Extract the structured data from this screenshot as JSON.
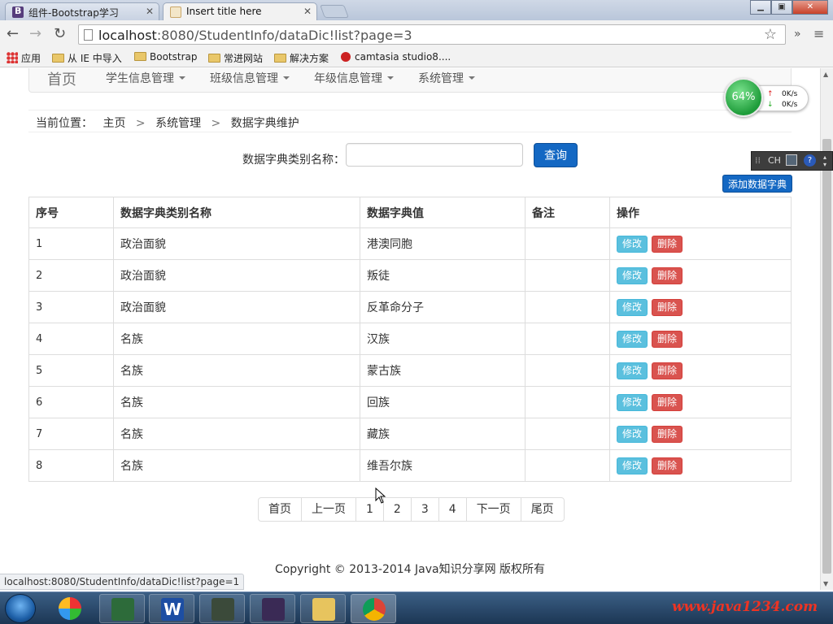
{
  "browser": {
    "tabs": [
      {
        "title": "组件-Bootstrap学习",
        "active": false,
        "favicon_color": "#563d7c"
      },
      {
        "title": "Insert title here",
        "active": true,
        "favicon_color": "#caa76a"
      }
    ],
    "url_host": "localhost",
    "url_rest": ":8080/StudentInfo/dataDic!list?page=3",
    "bookmarks": [
      {
        "label": "应用",
        "icon": "apps-icon"
      },
      {
        "label": "从 IE 中导入",
        "icon": "folder-icon"
      },
      {
        "label": "Bootstrap",
        "icon": "folder-icon"
      },
      {
        "label": "常进网站",
        "icon": "folder-icon"
      },
      {
        "label": "解决方案",
        "icon": "folder-icon"
      },
      {
        "label": "camtasia studio8....",
        "icon": "camtasia-icon"
      }
    ],
    "more_label": "»",
    "status_url": "localhost:8080/StudentInfo/dataDic!list?page=1"
  },
  "nav": {
    "brand": "首页",
    "menus": [
      "学生信息管理",
      "班级信息管理",
      "年级信息管理",
      "系统管理"
    ]
  },
  "breadcrumb": {
    "prefix": "当前位置：",
    "items": [
      "主页",
      "系统管理",
      "数据字典维护"
    ],
    "separator": ">"
  },
  "search": {
    "label": "数据字典类别名称：",
    "value": "",
    "button": "查询"
  },
  "add_button": "添加数据字典",
  "table": {
    "headers": [
      "序号",
      "数据字典类别名称",
      "数据字典值",
      "备注",
      "操作"
    ],
    "edit_label": "修改",
    "delete_label": "删除",
    "rows": [
      {
        "no": "1",
        "type": "政治面貌",
        "value": "港澳同胞",
        "remark": ""
      },
      {
        "no": "2",
        "type": "政治面貌",
        "value": "叛徒",
        "remark": ""
      },
      {
        "no": "3",
        "type": "政治面貌",
        "value": "反革命分子",
        "remark": ""
      },
      {
        "no": "4",
        "type": "名族",
        "value": "汉族",
        "remark": ""
      },
      {
        "no": "5",
        "type": "名族",
        "value": "蒙古族",
        "remark": ""
      },
      {
        "no": "6",
        "type": "名族",
        "value": "回族",
        "remark": ""
      },
      {
        "no": "7",
        "type": "名族",
        "value": "藏族",
        "remark": ""
      },
      {
        "no": "8",
        "type": "名族",
        "value": "维吾尔族",
        "remark": ""
      }
    ]
  },
  "pagination": [
    "首页",
    "上一页",
    "1",
    "2",
    "3",
    "4",
    "下一页",
    "尾页"
  ],
  "footer": "Copyright © 2013-2014 Java知识分享网 版权所有",
  "speed_widget": {
    "percent": "64%",
    "up": "0K/s",
    "down": "0K/s"
  },
  "ime": {
    "label": "CH"
  },
  "watermark": "www.java1234.com",
  "colors": {
    "primary": "#1468c3",
    "edit": "#5bc0de",
    "delete": "#d9534f",
    "speed": "#1e9c3a"
  }
}
